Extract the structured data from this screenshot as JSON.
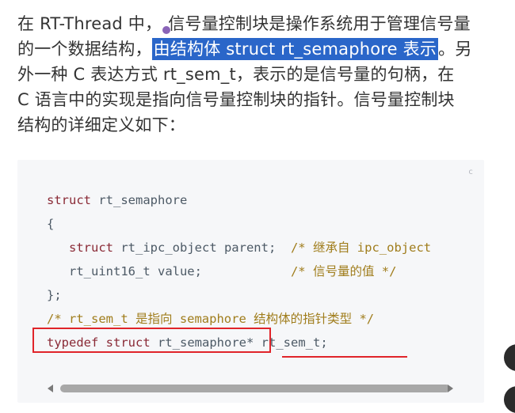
{
  "paragraph": {
    "line1_a": "在 RT-Thread 中，",
    "line1_b": "信号量控制块是操作系统用于管理信号量",
    "line2_a": "的一个数据结构，",
    "line2_hl": "由结构体 struct rt_semaphore 表示",
    "line2_b": "。另",
    "line3": "外一种 C 表达方式 rt_sem_t，表示的是信号量的句柄，在",
    "line4": "C 语言中的实现是指向信号量控制块的指针。信号量控制块",
    "line5": "结构的详细定义如下："
  },
  "code": {
    "copy_mark": "c",
    "l1_kw": "struct",
    "l1_name": " rt_semaphore",
    "l2": "{",
    "l3_indent": "   ",
    "l3_kw": "struct",
    "l3_rest": " rt_ipc_object parent;  ",
    "l3_comment": "/* 继承自 ipc_object",
    "l4_indent": "   ",
    "l4_rest": "rt_uint16_t value;            ",
    "l4_comment": "/* 信号量的值 */",
    "l5": "};",
    "l6_comment": "/* rt_sem_t 是指向 semaphore 结构体的指针类型 */",
    "l7_kw1": "typedef",
    "l7_sp1": " ",
    "l7_kw2": "struct",
    "l7_type": " rt_semaphore*",
    "l7_rest": " rt_sem_t",
    "l7_end": ";"
  },
  "colors": {
    "highlight": "#2a66c9",
    "annotation": "#e0242a",
    "keyword": "#8a2a36",
    "comment": "#a07d1c"
  }
}
